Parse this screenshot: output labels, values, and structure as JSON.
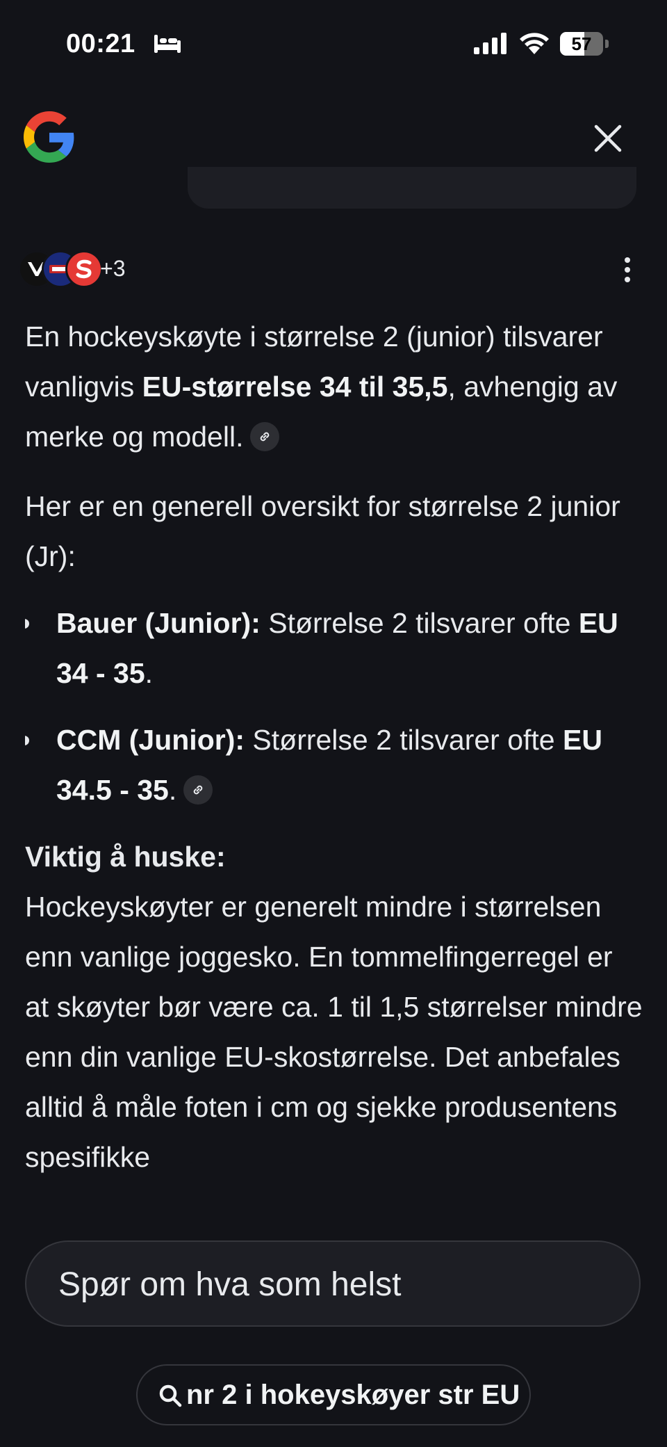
{
  "status_bar": {
    "time": "00:21",
    "battery_level": "57",
    "battery_fraction": 0.57
  },
  "header": {
    "logo": "google-logo",
    "close_icon": "close-icon"
  },
  "sources": {
    "count_label": "+3",
    "avatars": [
      "bauer-logo",
      "hockey-store-logo",
      "sport-s-logo"
    ]
  },
  "answer": {
    "para1": {
      "part1": "En hockeyskøyte i størrelse 2 (junior) tilsvarer vanligvis ",
      "bold": "EU-størrelse 34 til 35,5",
      "part2": ", avhengig av merke og modell."
    },
    "para2": "Her er en generell oversikt for størrelse 2 junior (Jr):",
    "bullets": [
      {
        "label": "Bauer (Junior):",
        "text": " Størrelse 2 tilsvarer ofte ",
        "value": "EU 34 - 35",
        "end": "."
      },
      {
        "label": "CCM (Junior):",
        "text": " Størrelse 2 tilsvarer ofte ",
        "value": "EU 34.5 - 35",
        "end": "."
      }
    ],
    "note_heading": "Viktig å huske:",
    "note_text": "Hockeyskøyter er generelt mindre i størrelsen enn vanlige joggesko. En tommelfingerregel er at skøyter bør være ca. 1 til 1,5 størrelser mindre enn din vanlige EU-skostørrelse. Det anbefales alltid å måle foten i cm og sjekke produsentens spesifikke"
  },
  "ask": {
    "placeholder": "Spør om hva som helst"
  },
  "search_chip": {
    "label": "nr 2 i hokeyskøyer str EU"
  }
}
